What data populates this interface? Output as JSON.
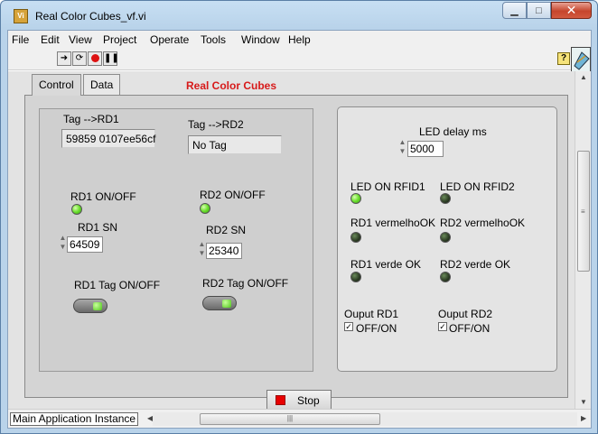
{
  "window": {
    "title": "Real Color Cubes_vf.vi",
    "app_icon": "labview-vi-icon"
  },
  "menu": [
    "File",
    "Edit",
    "View",
    "Project",
    "Operate",
    "Tools",
    "Window",
    "Help"
  ],
  "toolbar": {
    "help_glyph": "?"
  },
  "tabs": [
    {
      "label": "Control",
      "active": true
    },
    {
      "label": "Data",
      "active": false
    }
  ],
  "panel_title": "Real Color Cubes",
  "left": {
    "tag_rd1_label": "Tag -->RD1",
    "tag_rd1_value": "59859 0107ee56cf",
    "tag_rd2_label": "Tag -->RD2",
    "tag_rd2_value": "No Tag",
    "rd1_onoff_label": "RD1 ON/OFF",
    "rd1_onoff_state": true,
    "rd2_onoff_label": "RD2 ON/OFF",
    "rd2_onoff_state": true,
    "rd1_sn_label": "RD1 SN",
    "rd1_sn_value": "64509",
    "rd2_sn_label": "RD2 SN",
    "rd2_sn_value": "25340",
    "rd1_tag_label": "RD1 Tag  ON/OFF",
    "rd2_tag_label": "RD2 Tag ON/OFF"
  },
  "right": {
    "led_delay_label": "LED delay ms",
    "led_delay_value": "5000",
    "led_on_rfid1_label": "LED ON RFID1",
    "led_on_rfid1_state": true,
    "led_on_rfid2_label": "LED ON RFID2",
    "led_on_rfid2_state": false,
    "rd1_vermelho_label": "RD1 vermelhoOK",
    "rd1_vermelho_state": false,
    "rd2_vermelho_label": "RD2 vermelhoOK",
    "rd2_vermelho_state": false,
    "rd1_verde_label": "RD1 verde OK",
    "rd1_verde_state": false,
    "rd2_verde_label": "RD2 verde OK",
    "rd2_verde_state": false,
    "output_rd1_label": "Ouput RD1",
    "output_rd1_check_label": "OFF/ON",
    "output_rd1_checked": true,
    "output_rd2_label": "Ouput RD2",
    "output_rd2_check_label": "OFF/ON",
    "output_rd2_checked": true
  },
  "stop_button": {
    "label": "Stop"
  },
  "status": {
    "context": "Main Application Instance"
  },
  "colors": {
    "panel_title": "#d71a1a",
    "led_on": "#6adf2d",
    "led_off": "#2a3a22",
    "stop": "#e80000"
  }
}
